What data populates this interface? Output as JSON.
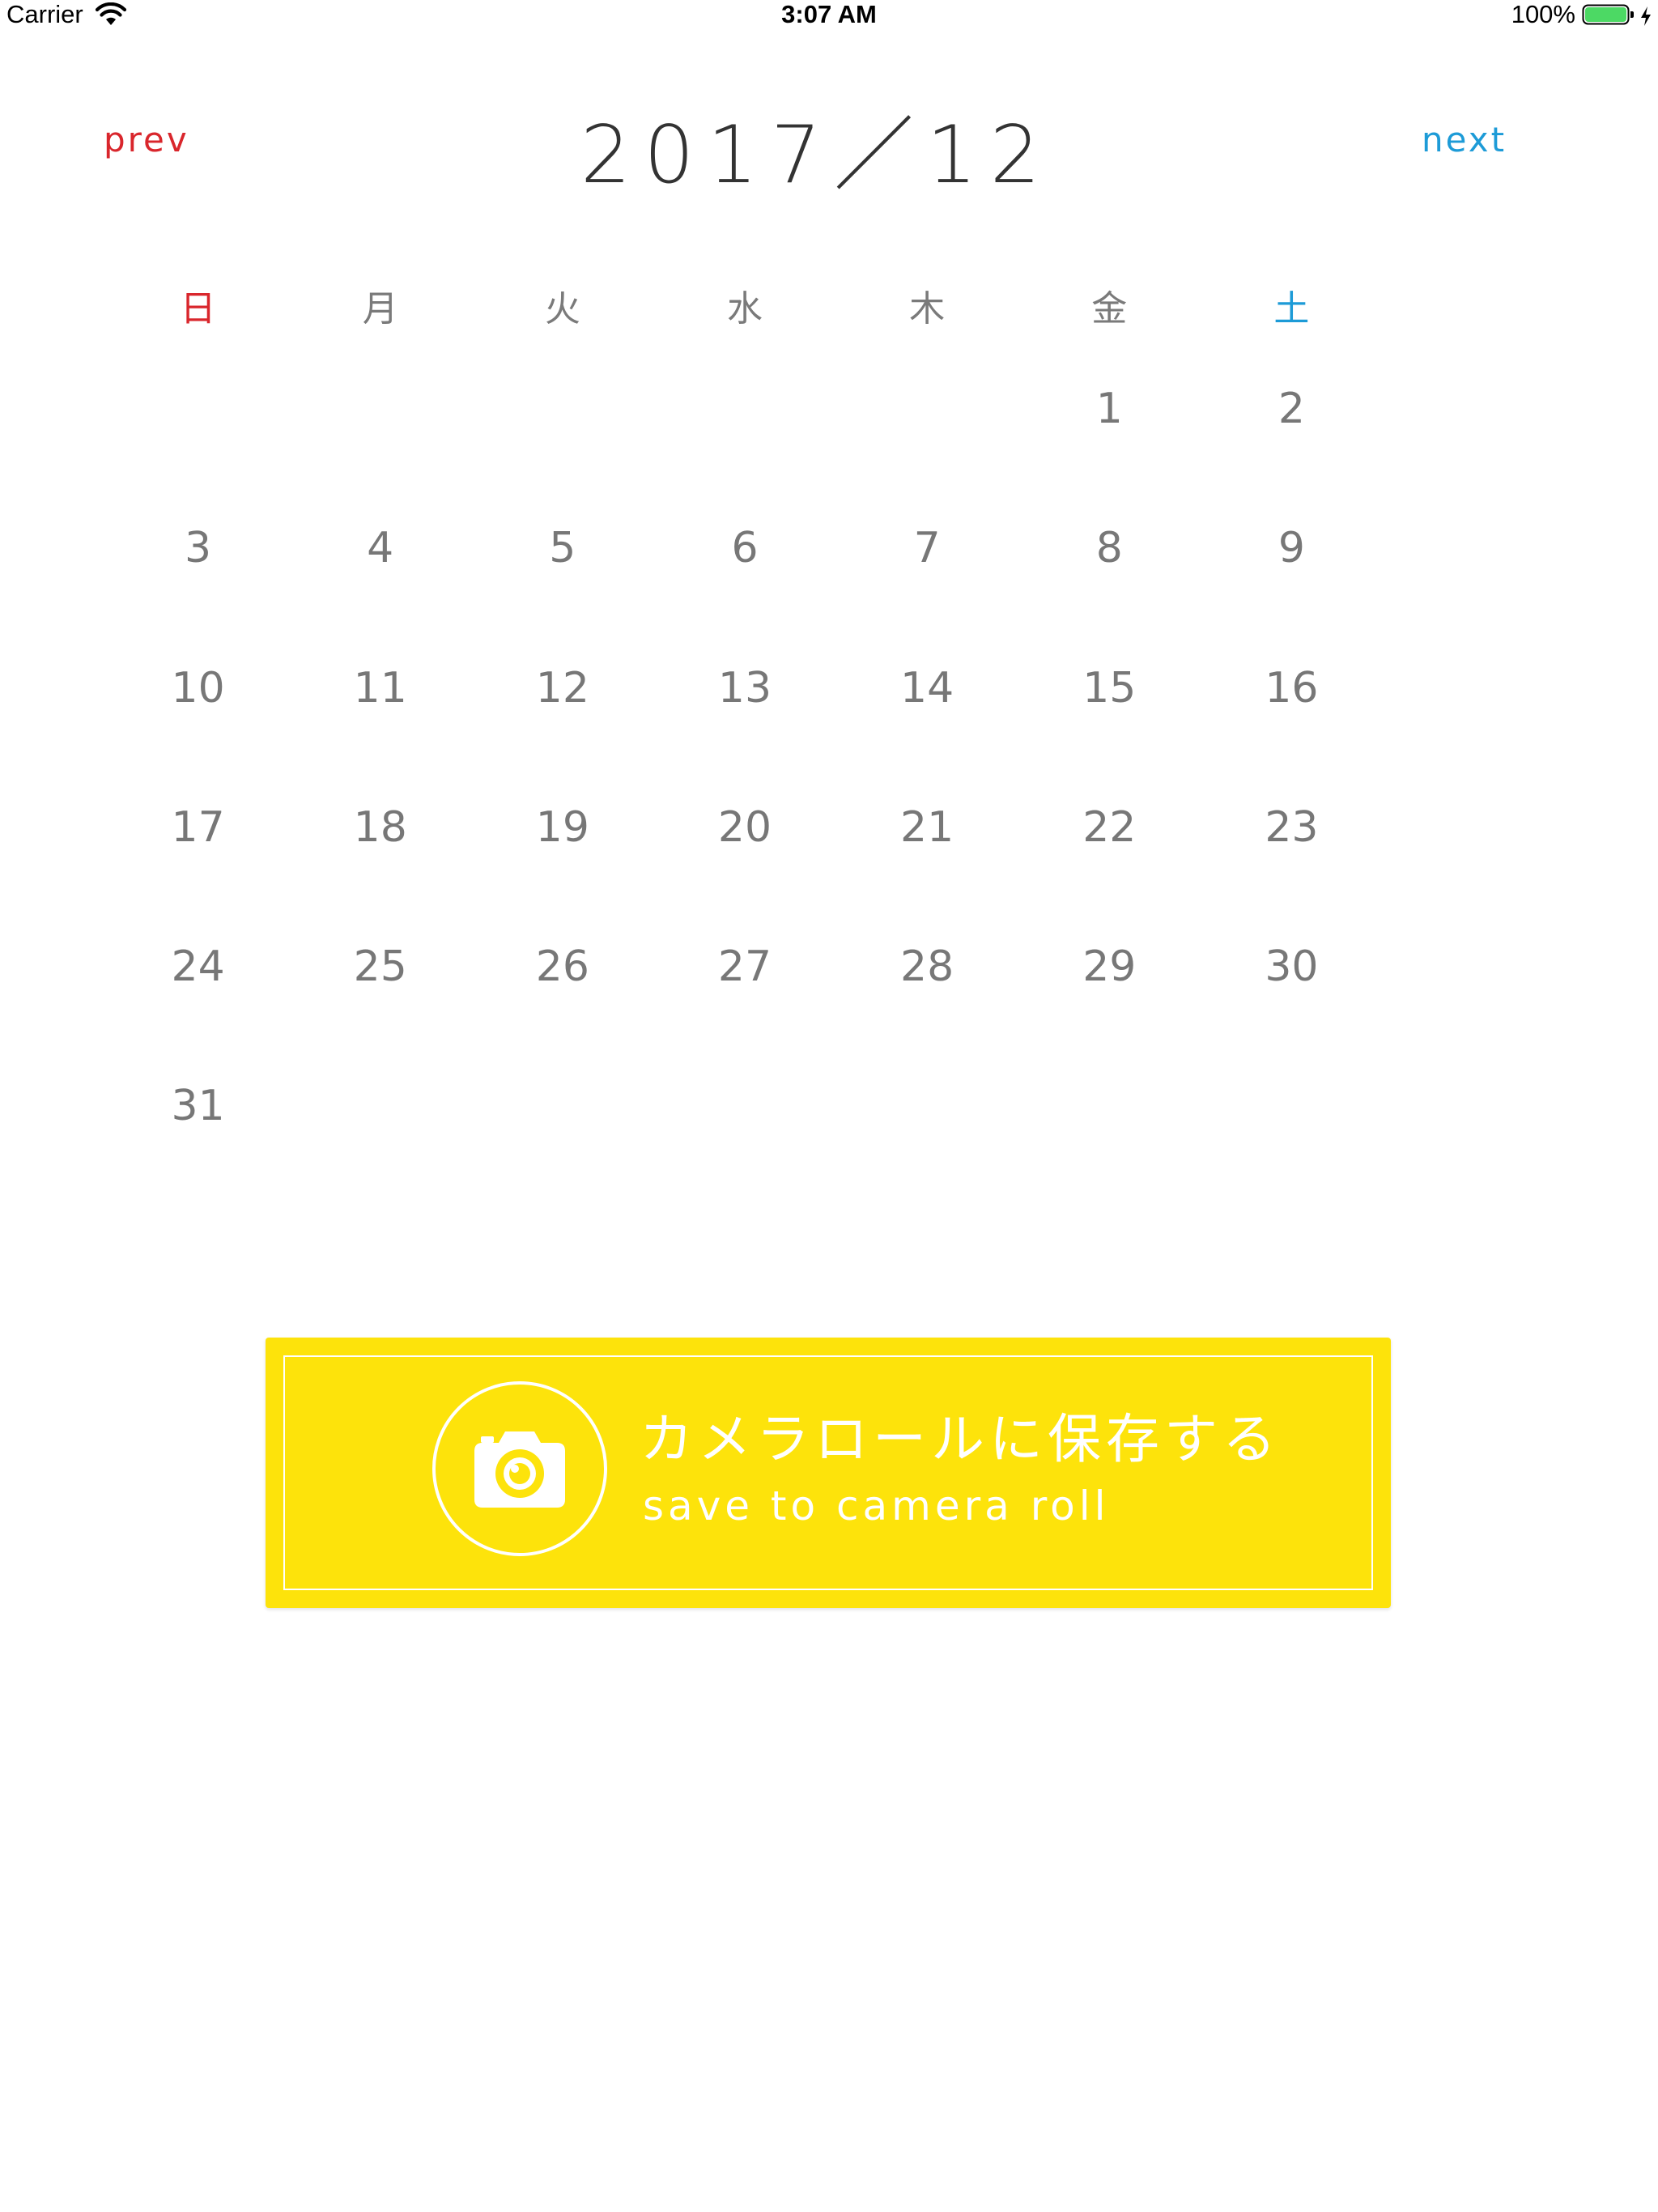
{
  "status_bar": {
    "carrier": "Carrier",
    "time": "3:07 AM",
    "battery_percent": "100%",
    "battery_level": 1.0,
    "battery_color": "#4cd964"
  },
  "header": {
    "prev_label": "prev",
    "next_label": "next",
    "month_title": "2017／12",
    "prev_color": "#d9262c",
    "next_color": "#1d9bd7"
  },
  "calendar": {
    "weekdays": [
      "日",
      "月",
      "火",
      "水",
      "木",
      "金",
      "土"
    ],
    "weeks": [
      [
        "",
        "",
        "",
        "",
        "",
        "1",
        "2"
      ],
      [
        "3",
        "4",
        "5",
        "6",
        "7",
        "8",
        "9"
      ],
      [
        "10",
        "11",
        "12",
        "13",
        "14",
        "15",
        "16"
      ],
      [
        "17",
        "18",
        "19",
        "20",
        "21",
        "22",
        "23"
      ],
      [
        "24",
        "25",
        "26",
        "27",
        "28",
        "29",
        "30"
      ],
      [
        "31",
        "",
        "",
        "",
        "",
        "",
        ""
      ]
    ]
  },
  "save_button": {
    "label_jp": "カメラロールに保存する",
    "label_en": "save to camera roll",
    "icon": "camera-icon",
    "background_color": "#fde30b"
  }
}
